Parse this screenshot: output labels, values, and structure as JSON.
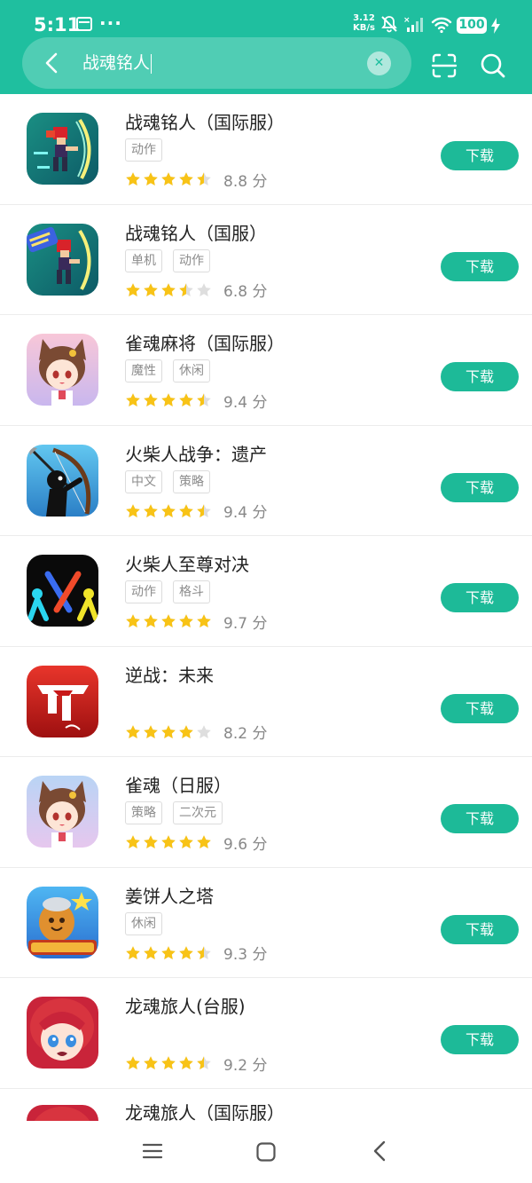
{
  "status_bar": {
    "time": "5:11",
    "dots": "···",
    "speed_value": "3.12",
    "speed_unit": "KB/s",
    "battery": "100"
  },
  "search": {
    "query": "战魂铭人"
  },
  "colors": {
    "accent": "#1fbf9f",
    "star": "#f8c316",
    "star_empty": "#dedede"
  },
  "download_label": "下载",
  "apps": [
    {
      "name": "战魂铭人（国际服）",
      "tags": [
        "动作"
      ],
      "score": "8.8 分",
      "stars": 4.5,
      "icon": "pixel-warrior-icon"
    },
    {
      "name": "战魂铭人（国服）",
      "tags": [
        "单机",
        "动作"
      ],
      "score": "6.8 分",
      "stars": 3.5,
      "icon": "pixel-warrior-event-icon"
    },
    {
      "name": "雀魂麻将（国际服）",
      "tags": [
        "魔性",
        "休闲"
      ],
      "score": "9.4 分",
      "stars": 4.5,
      "icon": "anime-catgirl-icon"
    },
    {
      "name": "火柴人战争：遗产",
      "tags": [
        "中文",
        "策略"
      ],
      "score": "9.4 分",
      "stars": 4.5,
      "icon": "stickman-archer-icon"
    },
    {
      "name": "火柴人至尊对决",
      "tags": [
        "动作",
        "格斗"
      ],
      "score": "9.7 分",
      "stars": 5,
      "icon": "stickman-duel-icon"
    },
    {
      "name": "逆战：未来",
      "tags": [],
      "score": "8.2 分",
      "stars": 4,
      "icon": "nizhan-logo-icon"
    },
    {
      "name": "雀魂（日服）",
      "tags": [
        "策略",
        "二次元"
      ],
      "score": "9.6 分",
      "stars": 5,
      "icon": "anime-catgirl-icon"
    },
    {
      "name": "姜饼人之塔",
      "tags": [
        "休闲"
      ],
      "score": "9.3 分",
      "stars": 4.5,
      "icon": "cookie-adventures-icon"
    },
    {
      "name": "龙魂旅人(台服)",
      "tags": [],
      "score": "9.2 分",
      "stars": 4.5,
      "icon": "anime-redhair-girl-icon"
    },
    {
      "name": "龙魂旅人（国际服）",
      "tags": [],
      "score": "",
      "stars": 0,
      "icon": "anime-redhair-girl-icon"
    }
  ]
}
